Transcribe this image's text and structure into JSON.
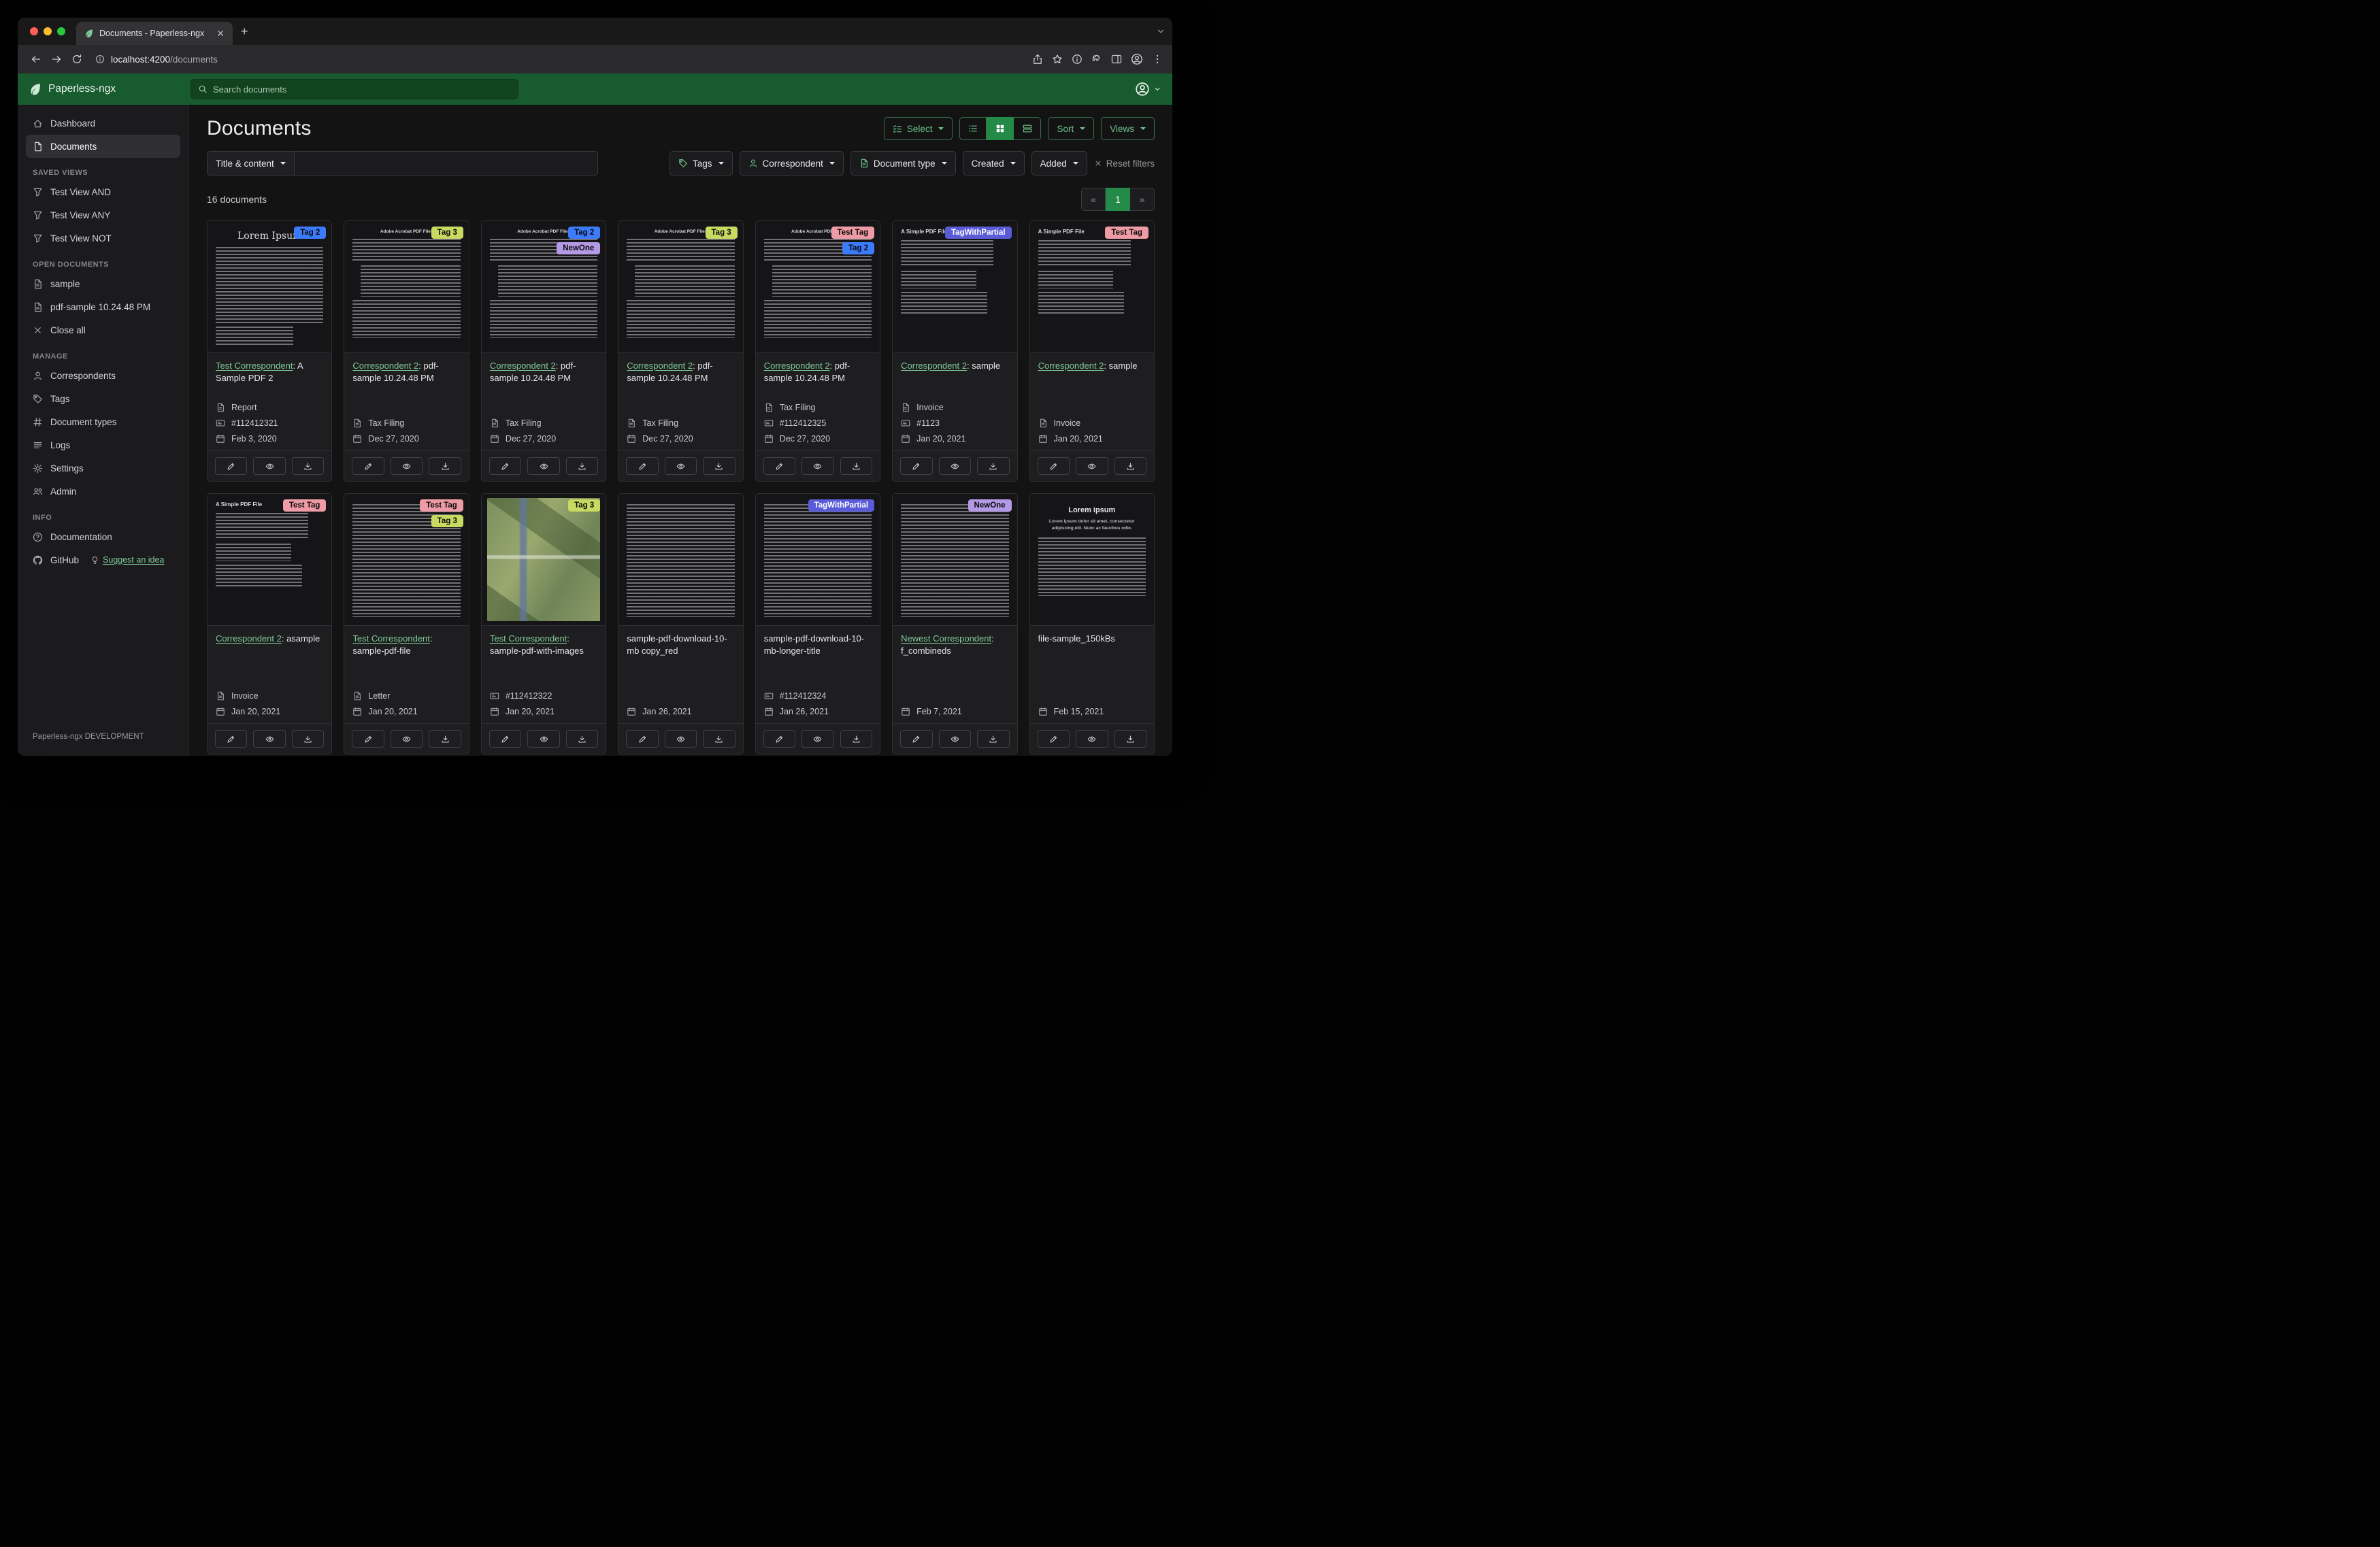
{
  "browser": {
    "tab_title": "Documents - Paperless-ngx",
    "url_host": "localhost:4200",
    "url_path": "/documents",
    "new_tab_label": "+",
    "toolbar_icons": [
      "share",
      "star",
      "info",
      "puzzle",
      "panel",
      "avatar",
      "kebab"
    ]
  },
  "app": {
    "brand": "Paperless-ngx",
    "search_placeholder": "Search documents"
  },
  "sidebar": {
    "sections": [
      {
        "header": "",
        "items": [
          {
            "icon": "house",
            "label": "Dashboard"
          },
          {
            "icon": "file",
            "label": "Documents",
            "active": true
          }
        ]
      },
      {
        "header": "SAVED VIEWS",
        "items": [
          {
            "icon": "funnel",
            "label": "Test View AND"
          },
          {
            "icon": "funnel",
            "label": "Test View ANY"
          },
          {
            "icon": "funnel",
            "label": "Test View NOT"
          }
        ]
      },
      {
        "header": "OPEN DOCUMENTS",
        "items": [
          {
            "icon": "filetext",
            "label": "sample"
          },
          {
            "icon": "filetext",
            "label": "pdf-sample 10.24.48 PM"
          },
          {
            "icon": "x",
            "label": "Close all"
          }
        ]
      },
      {
        "header": "MANAGE",
        "items": [
          {
            "icon": "person",
            "label": "Correspondents"
          },
          {
            "icon": "tag",
            "label": "Tags"
          },
          {
            "icon": "hash",
            "label": "Document types"
          },
          {
            "icon": "list",
            "label": "Logs"
          },
          {
            "icon": "gear",
            "label": "Settings"
          },
          {
            "icon": "people",
            "label": "Admin"
          }
        ]
      },
      {
        "header": "INFO",
        "items": [
          {
            "icon": "question",
            "label": "Documentation"
          },
          {
            "icon": "github",
            "label": "GitHub",
            "extra_icon": "bulb",
            "extra": "Suggest an idea"
          }
        ]
      }
    ],
    "footer": "Paperless-ngx DEVELOPMENT"
  },
  "main": {
    "title": "Documents",
    "select_label": "Select",
    "sort_label": "Sort",
    "views_label": "Views",
    "count_label": "16 documents",
    "pagination": {
      "prev": "«",
      "page": "1",
      "next": "»"
    },
    "view_toggles": [
      {
        "icon": "listul",
        "active": false
      },
      {
        "icon": "grid",
        "active": true
      },
      {
        "icon": "rows",
        "active": false
      }
    ]
  },
  "filters": {
    "title_dropdown": "Title & content",
    "query_value": "",
    "buttons": [
      {
        "icon": "tag",
        "label": "Tags"
      },
      {
        "icon": "person",
        "label": "Correspondent"
      },
      {
        "icon": "filetext",
        "label": "Document type"
      },
      {
        "icon": "",
        "label": "Created"
      },
      {
        "icon": "",
        "label": "Added"
      }
    ],
    "reset_label": "Reset filters"
  },
  "tag_styles": {
    "Tag 2": {
      "bg": "#3d7bfd",
      "fg": "#0a0a0a"
    },
    "Tag 3": {
      "bg": "#c9da60",
      "fg": "#0a0a0a"
    },
    "NewOne": {
      "bg": "#b49ae6",
      "fg": "#0a0a0a"
    },
    "Test Tag": {
      "bg": "#ef9ba5",
      "fg": "#0a0a0a"
    },
    "TagWithPartial": {
      "bg": "#5a5bd8",
      "fg": "#ffffff"
    }
  },
  "thumb_texts": {
    "lorem": "Lorem Ipsum",
    "acrobat": "Adobe Acrobat PDF Files",
    "simple": "A Simple PDF File",
    "loremcenter": "Lorem ipsum",
    "loremcenter_sub": "Lorem ipsum dolor sit amet, consectetur adipiscing elit. Nunc ac faucibus odio."
  },
  "documents": [
    {
      "tags": [
        "Tag 2"
      ],
      "thumb": "lorem",
      "link": "Test Correspondent",
      "title": ": A Sample PDF 2",
      "type": "Report",
      "asn": "#112412321",
      "date": "Feb 3, 2020"
    },
    {
      "tags": [
        "Tag 3"
      ],
      "thumb": "acrobat",
      "link": "Correspondent 2",
      "title": ": pdf-sample 10.24.48 PM",
      "type": "Tax Filing",
      "date": "Dec 27, 2020"
    },
    {
      "tags": [
        "Tag 2",
        "NewOne"
      ],
      "thumb": "acrobat",
      "link": "Correspondent 2",
      "title": ": pdf-sample 10.24.48 PM",
      "type": "Tax Filing",
      "date": "Dec 27, 2020"
    },
    {
      "tags": [
        "Tag 3"
      ],
      "thumb": "acrobat",
      "link": "Correspondent 2",
      "title": ": pdf-sample 10.24.48 PM",
      "type": "Tax Filing",
      "date": "Dec 27, 2020"
    },
    {
      "tags": [
        "Test Tag",
        "Tag 2"
      ],
      "thumb": "acrobat",
      "link": "Correspondent 2",
      "title": ": pdf-sample 10.24.48 PM",
      "type": "Tax Filing",
      "asn": "#112412325",
      "date": "Dec 27, 2020"
    },
    {
      "tags": [
        "TagWithPartial"
      ],
      "thumb": "simple",
      "link": "Correspondent 2",
      "title": ": sample",
      "type": "Invoice",
      "asn": "#1123",
      "date": "Jan 20, 2021"
    },
    {
      "tags": [
        "Test Tag"
      ],
      "thumb": "simple",
      "link": "Correspondent 2",
      "title": ": sample",
      "type": "Invoice",
      "date": "Jan 20, 2021"
    },
    {
      "tags": [
        "Test Tag"
      ],
      "thumb": "simple",
      "link": "Correspondent 2",
      "title": ": asample",
      "type": "Invoice",
      "date": "Jan 20, 2021"
    },
    {
      "tags": [
        "Test Tag",
        "Tag 3"
      ],
      "thumb": "dense",
      "link": "Test Correspondent",
      "title": ": sample-pdf-file",
      "type": "Letter",
      "date": "Jan 20, 2021"
    },
    {
      "tags": [
        "Tag 3"
      ],
      "thumb": "map",
      "link": "Test Correspondent",
      "title": ": sample-pdf-with-images",
      "asn": "#112412322",
      "date": "Jan 20, 2021"
    },
    {
      "tags": [],
      "thumb": "dense",
      "title": "sample-pdf-download-10-mb copy_red",
      "date": "Jan 26, 2021"
    },
    {
      "tags": [
        "TagWithPartial"
      ],
      "thumb": "dense",
      "title": "sample-pdf-download-10-mb-longer-title",
      "asn": "#112412324",
      "date": "Jan 26, 2021"
    },
    {
      "tags": [
        "NewOne"
      ],
      "thumb": "dense",
      "link": "Newest Correspondent",
      "title": ": f_combineds",
      "date": "Feb 7, 2021"
    },
    {
      "tags": [],
      "thumb": "loremcenter",
      "title": "file-sample_150kBs",
      "date": "Feb 15, 2021"
    }
  ]
}
